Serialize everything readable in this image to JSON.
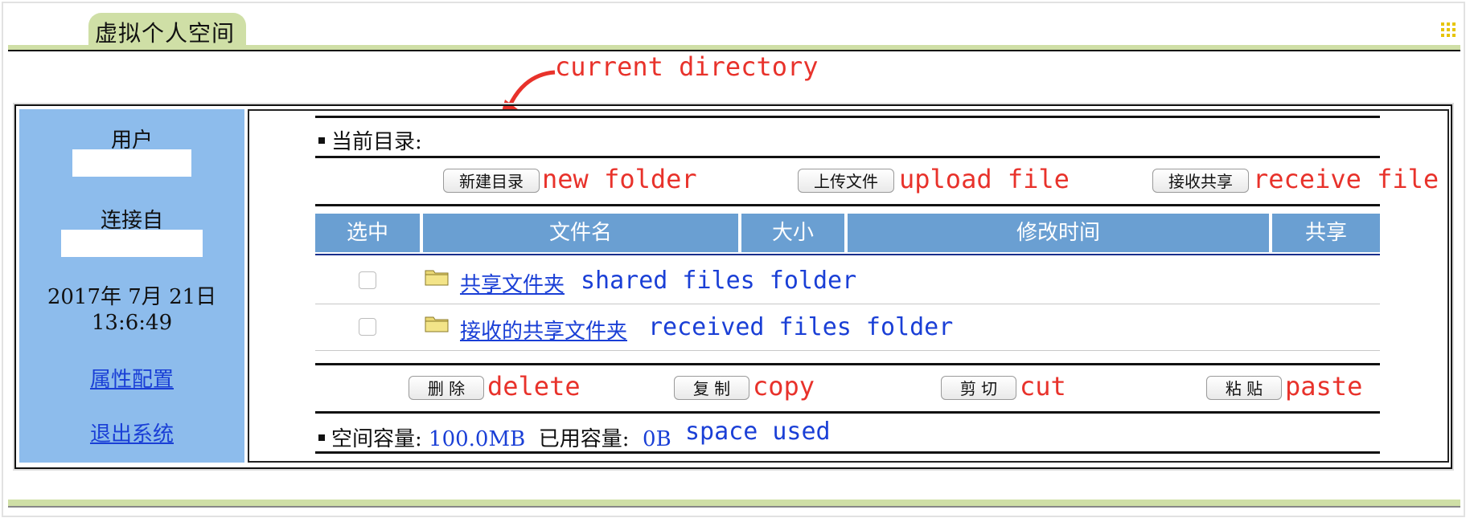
{
  "app": {
    "title": "虚拟个人空间"
  },
  "sidebar": {
    "user_label": "用户",
    "connected_from_label": "连接自",
    "date": "2017年 7月 21日",
    "time": "13:6:49",
    "links": [
      {
        "label": "属性配置"
      },
      {
        "label": "退出系统"
      }
    ]
  },
  "main": {
    "current_dir_label": "当前目录:",
    "toolbar": {
      "new_folder": "新建目录",
      "upload_file": "上传文件",
      "receive_share": "接收共享"
    },
    "table": {
      "headers": [
        "选中",
        "文件名",
        "大小",
        "修改时间",
        "共享"
      ],
      "rows": [
        {
          "name": "共享文件夹",
          "note": "shared files folder",
          "icon": "folder-icon"
        },
        {
          "name": "接收的共享文件夹",
          "note": "received files folder",
          "icon": "folder-icon"
        }
      ]
    },
    "actions": {
      "delete": "删 除",
      "copy": "复 制",
      "cut": "剪 切",
      "paste": "粘 贴"
    },
    "capacity": {
      "space_label": "空间容量:",
      "space_value": "100.0MB",
      "used_label": "已用容量:",
      "used_value": "0B"
    }
  },
  "annotations": {
    "current_directory": "current directory",
    "new_folder": "new folder",
    "upload_file": "upload file",
    "receive_file": "receive file",
    "delete": "delete",
    "copy": "copy",
    "cut": "cut",
    "paste": "paste",
    "space_used": "space used"
  },
  "colors": {
    "accent_green": "#cfdfa6",
    "sidebar_blue": "#8dbcec",
    "table_header": "#6a9fd2",
    "link_blue": "#1a3fd6",
    "annotation_red": "#e8322b"
  }
}
